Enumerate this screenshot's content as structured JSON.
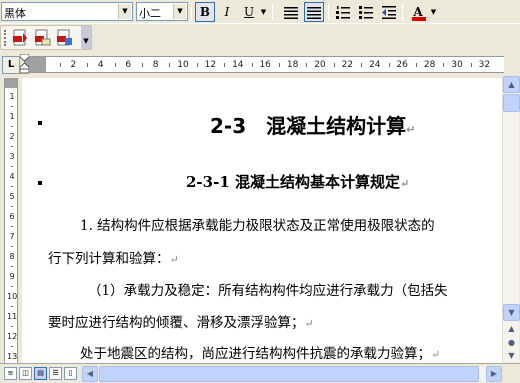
{
  "toolbar": {
    "font_name": "黑体",
    "font_size": "小二",
    "bold_label": "B",
    "italic_label": "I",
    "underline_label": "U",
    "font_color_label": "A",
    "colors": {
      "font_color_bar": "#e00000",
      "active_border": "#316ac5"
    }
  },
  "ruler": {
    "tab_selector": "L",
    "numbers": [
      "2",
      "4",
      "6",
      "8",
      "10",
      "12",
      "14",
      "16",
      "18",
      "20",
      "22",
      "24",
      "26",
      "28",
      "30",
      "32"
    ],
    "vertical_numbers": [
      "1",
      "1",
      "2",
      "3",
      "4",
      "5",
      "6",
      "7",
      "8",
      "9",
      "10",
      "11",
      "12",
      "13"
    ]
  },
  "document": {
    "heading1": "2-3　混凝土结构计算",
    "heading2": "2-3-1  混凝土结构基本计算规定",
    "para_mark": "↵",
    "lines": [
      "1. 结构构件应根据承载能力极限状态及正常使用极限状态的",
      "行下列计算和验算：",
      "（1）承载力及稳定：所有结构构件均应进行承载力（包括失",
      "要时应进行结构的倾覆、滑移及漂浮验算；",
      "处于地震区的结构，尚应进行结构构件抗震的承载力验算；"
    ]
  }
}
